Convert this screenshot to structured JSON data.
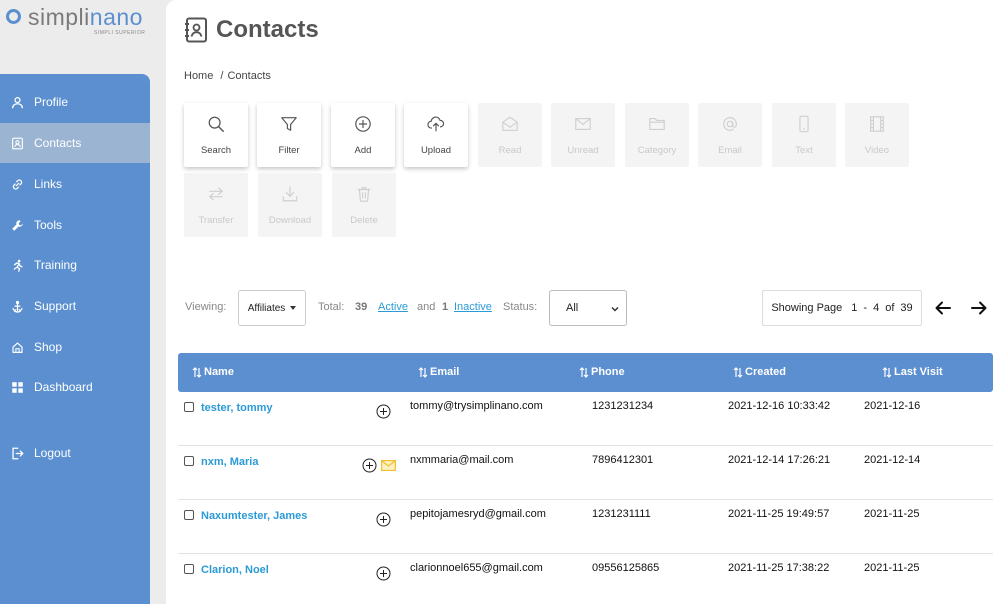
{
  "logo": {
    "brand_left": "simpli",
    "brand_right": "nano",
    "tagline": "SIMPLI SUPERIOR"
  },
  "sidebar": {
    "items": [
      {
        "label": "Profile",
        "icon": "person-icon"
      },
      {
        "label": "Contacts",
        "icon": "contacts-icon",
        "active": true
      },
      {
        "label": "Links",
        "icon": "link-icon"
      },
      {
        "label": "Tools",
        "icon": "wrench-icon"
      },
      {
        "label": "Training",
        "icon": "runner-icon"
      },
      {
        "label": "Support",
        "icon": "support-icon"
      },
      {
        "label": "Shop",
        "icon": "shop-icon"
      },
      {
        "label": "Dashboard",
        "icon": "dashboard-icon"
      },
      {
        "label": "Logout",
        "icon": "logout-icon"
      }
    ]
  },
  "page": {
    "title": "Contacts"
  },
  "breadcrumb": {
    "home": "Home",
    "separator": "/",
    "current": "Contacts"
  },
  "toolbar": {
    "buttons": [
      {
        "label": "Search",
        "enabled": true
      },
      {
        "label": "Filter",
        "enabled": true
      },
      {
        "label": "Add",
        "enabled": true
      },
      {
        "label": "Upload",
        "enabled": true
      },
      {
        "label": "Read",
        "enabled": false
      },
      {
        "label": "Unread",
        "enabled": false
      },
      {
        "label": "Category",
        "enabled": false
      },
      {
        "label": "Email",
        "enabled": false
      },
      {
        "label": "Text",
        "enabled": false
      },
      {
        "label": "Video",
        "enabled": false
      },
      {
        "label": "Transfer",
        "enabled": false
      },
      {
        "label": "Download",
        "enabled": false
      },
      {
        "label": "Delete",
        "enabled": false
      }
    ]
  },
  "filters": {
    "viewing_label": "Viewing:",
    "viewing_value": "Affiliates",
    "total_label": "Total:",
    "total_count": "39",
    "active_label": "Active",
    "and_label": "and",
    "inactive_count": "1",
    "inactive_label": "Inactive",
    "status_label": "Status:",
    "status_value": "All"
  },
  "pager": {
    "label": "Showing Page",
    "from": "1",
    "dash": "-",
    "to": "4",
    "of": "of",
    "total": "39"
  },
  "table": {
    "columns": [
      "Name",
      "Email",
      "Phone",
      "Created",
      "Last Visit"
    ],
    "rows": [
      {
        "name": "tester, tommy",
        "email": "tommy@trysimplinano.com",
        "phone": "1231231234",
        "created": "2021-12-16 10:33:42",
        "last_visit": "2021-12-16",
        "has_mail": false
      },
      {
        "name": "nxm, Maria",
        "email": "nxmmaria@mail.com",
        "phone": "7896412301",
        "created": "2021-12-14 17:26:21",
        "last_visit": "2021-12-14",
        "has_mail": true
      },
      {
        "name": "Naxumtester, James",
        "email": "pepitojamesryd@gmail.com",
        "phone": "1231231111",
        "created": "2021-11-25 19:49:57",
        "last_visit": "2021-11-25",
        "has_mail": false
      },
      {
        "name": "Clarion, Noel",
        "email": "clarionnoel655@gmail.com",
        "phone": "09556125865",
        "created": "2021-11-25 17:38:22",
        "last_visit": "2021-11-25",
        "has_mail": false
      }
    ]
  },
  "colors": {
    "accent": "#5b8fcf",
    "link": "#2a9bd6",
    "mail_icon": "#f0c030"
  }
}
